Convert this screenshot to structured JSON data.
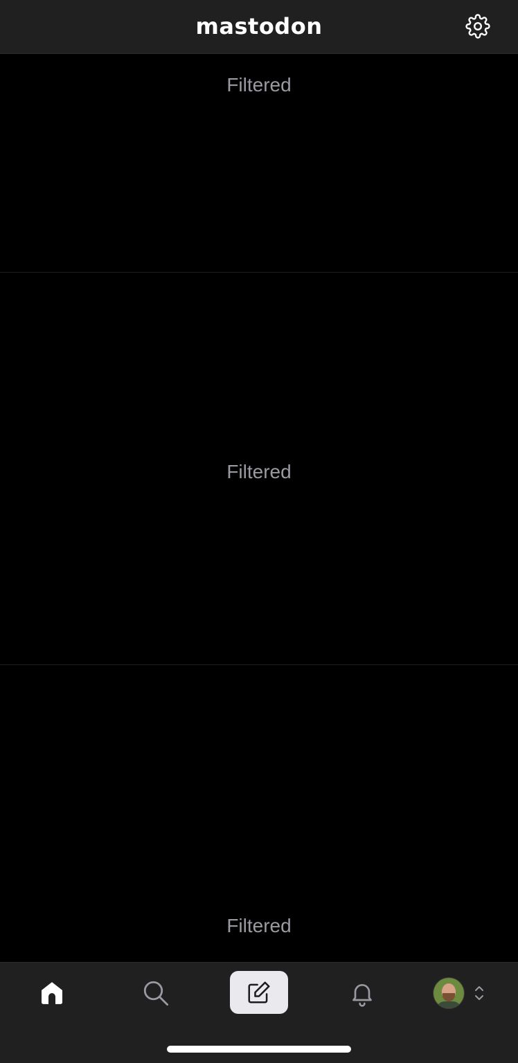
{
  "header": {
    "brand": "mastodon",
    "settings_icon": "gear-icon"
  },
  "timeline": {
    "posts": [
      {
        "label": "Filtered"
      },
      {
        "label": "Filtered"
      },
      {
        "label": "Filtered"
      }
    ]
  },
  "tabbar": {
    "tabs": [
      {
        "name": "home",
        "icon": "home-icon",
        "selected": true
      },
      {
        "name": "search",
        "icon": "search-icon",
        "selected": false
      },
      {
        "name": "compose",
        "icon": "compose-icon",
        "selected": false
      },
      {
        "name": "notifications",
        "icon": "bell-icon",
        "selected": false
      },
      {
        "name": "profile",
        "icon": "avatar",
        "selected": false
      }
    ]
  },
  "colors": {
    "background": "#000000",
    "bar": "#202020",
    "muted_text": "#9a9aa2",
    "compose_bg": "#e9e9ee"
  }
}
